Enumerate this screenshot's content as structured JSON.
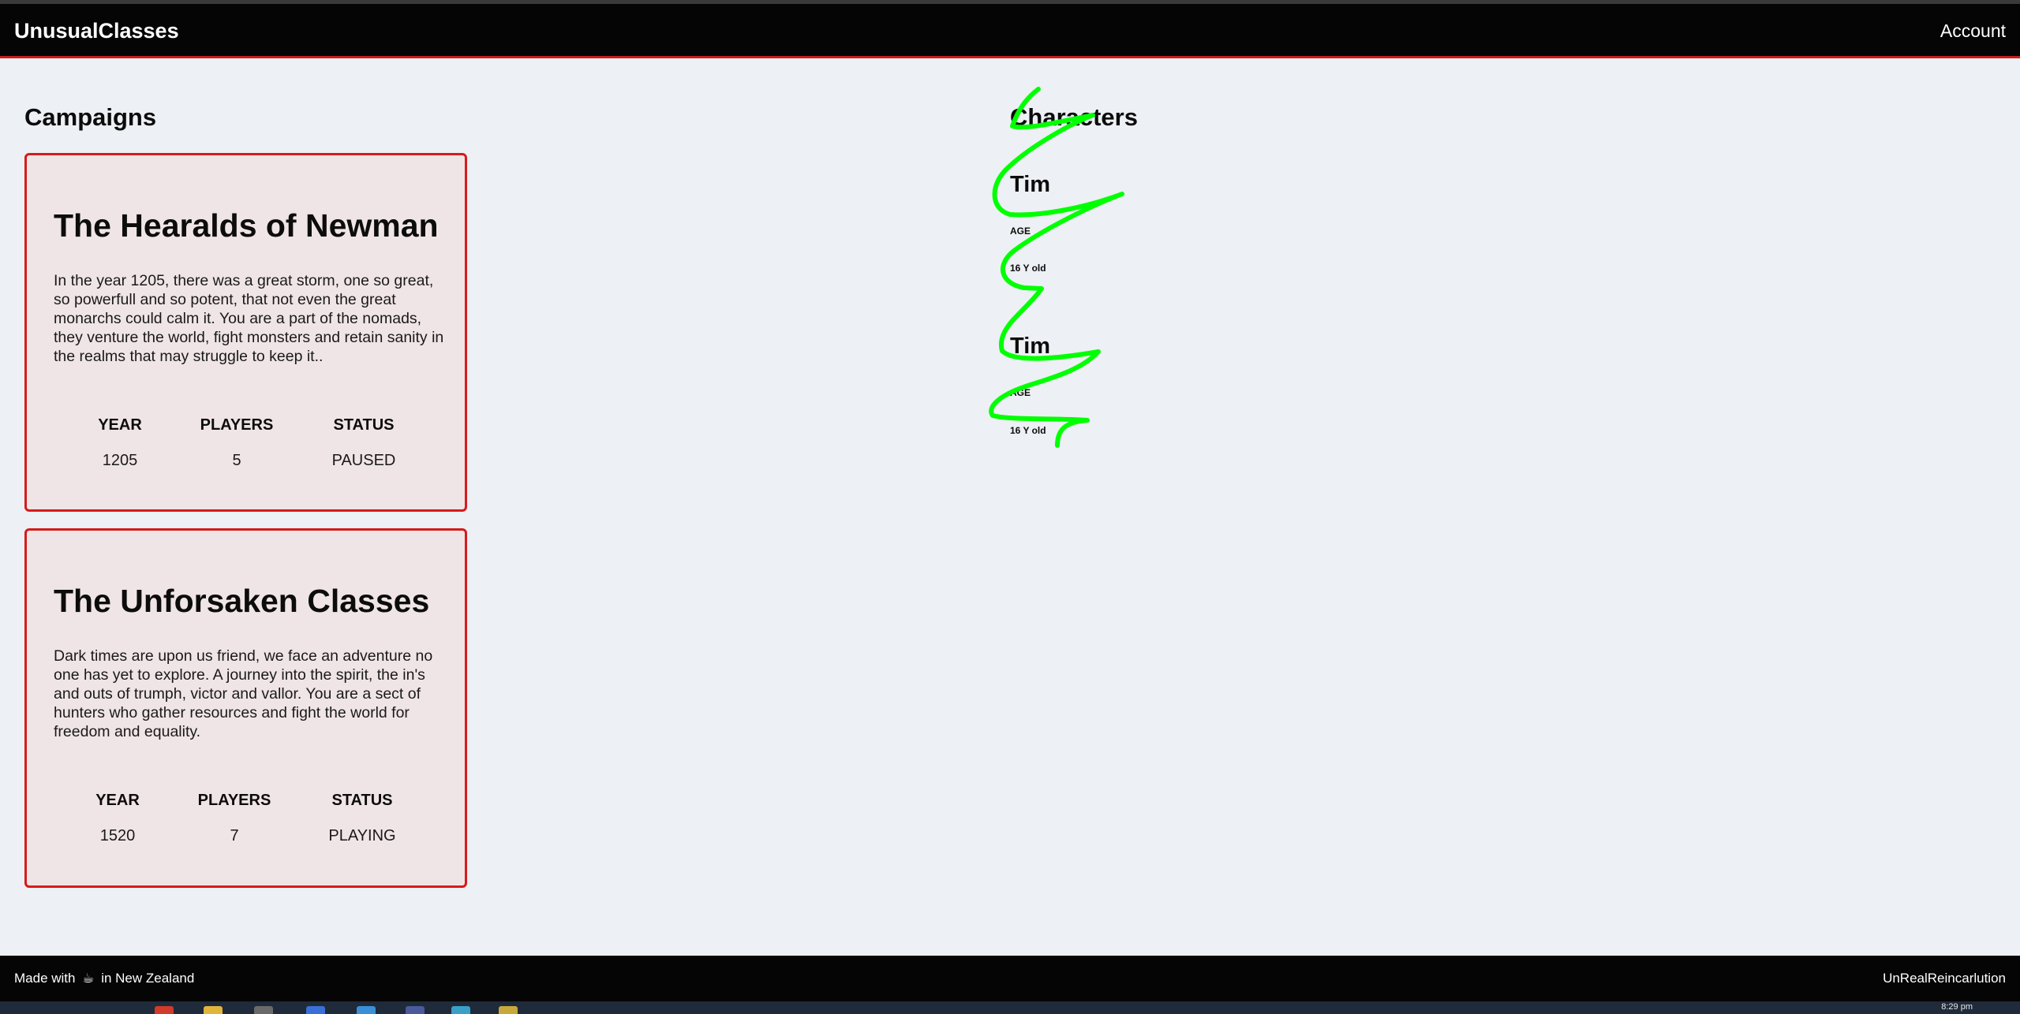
{
  "header": {
    "brand": "UnusualClasses",
    "account": "Account"
  },
  "campaigns": {
    "title": "Campaigns",
    "items": [
      {
        "title": "The Hearalds of Newman",
        "description": "In the year 1205, there was a great storm, one so great, so powerfull and so potent, that not even the great monarchs could calm it. You are a part of the nomads, they venture the world, fight monsters and retain sanity in the realms that may struggle to keep it..",
        "year_label": "YEAR",
        "players_label": "PLAYERS",
        "status_label": "STATUS",
        "year": "1205",
        "players": "5",
        "status": "PAUSED"
      },
      {
        "title": "The Unforsaken Classes",
        "description": "Dark times are upon us friend, we face an adventure no one has yet to explore. A journey into the spirit, the in's and outs of trumph, victor and vallor. You are a sect of hunters who gather resources and fight the world for freedom and equality.",
        "year_label": "YEAR",
        "players_label": "PLAYERS",
        "status_label": "STATUS",
        "year": "1520",
        "players": "7",
        "status": "PLAYING"
      }
    ]
  },
  "characters": {
    "title": "Characters",
    "items": [
      {
        "name": "Tim",
        "age_label": "AGE",
        "age": "16 Y old"
      },
      {
        "name": "Tim",
        "age_label": "AGE",
        "age": "16 Y old"
      }
    ]
  },
  "footer": {
    "made_with": "Made with",
    "coffee_icon": "☕",
    "location": "in New Zealand",
    "right": "UnRealReincarlution"
  },
  "taskbar": {
    "time": "8:29 pm"
  },
  "colors": {
    "accent": "#d61b1b",
    "scribble": "#00ff00",
    "header_bg": "#050505",
    "page_bg": "#edf0f4",
    "card_bg": "#f0e5e6"
  },
  "icons": [
    "coffee-icon"
  ]
}
